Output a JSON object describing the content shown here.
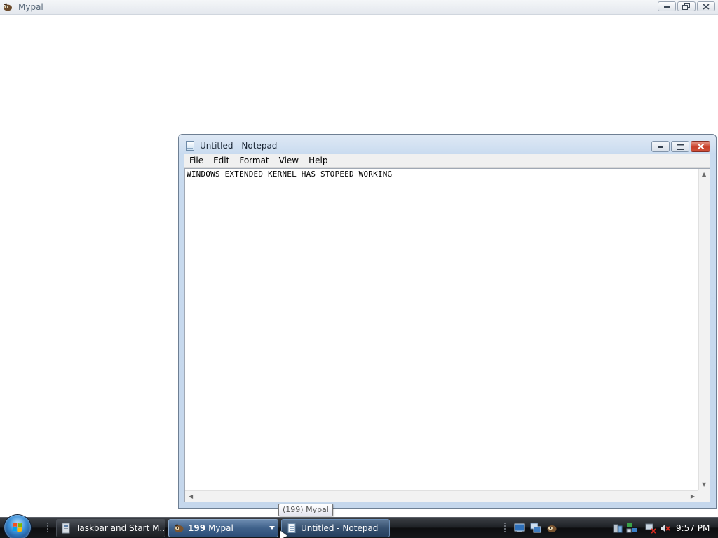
{
  "background_window": {
    "title": "Mypal",
    "icon": "mypal-icon"
  },
  "notepad": {
    "title": "Untitled - Notepad",
    "menu": [
      "File",
      "Edit",
      "Format",
      "View",
      "Help"
    ],
    "text_before_caret": "WINDOWS EXTENDED KERNEL HA",
    "text_after_caret": "S STOPEED WORKING"
  },
  "tooltip": {
    "text": "(199) Mypal"
  },
  "taskbar": {
    "buttons": [
      {
        "label": "Taskbar and Start M...",
        "icon": "control-panel-icon"
      },
      {
        "count": "199",
        "label": "Mypal",
        "icon": "mypal-icon"
      },
      {
        "label": "Untitled - Notepad",
        "icon": "notepad-icon"
      }
    ],
    "quick_launch": [
      "show-desktop-icon",
      "switch-windows-icon",
      "mypal-icon"
    ],
    "tray": [
      "safely-remove-hardware-icon",
      "network-icon",
      "network-disconnected-icon",
      "volume-muted-icon"
    ],
    "clock": "9:57 PM"
  },
  "colors": {
    "taskbar": "#1f2226",
    "notepad_frame": "#c9dbef",
    "close_button": "#c8402b",
    "start_orb": "#3a8fd8"
  }
}
